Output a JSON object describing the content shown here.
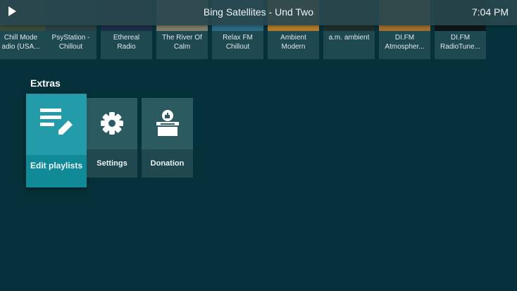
{
  "topbar": {
    "title": "Bing Satellites - Und Two",
    "time": "7:04 PM"
  },
  "stations": [
    {
      "label": "Chill Mode\nadio (USA...",
      "color": "#3a4a3c"
    },
    {
      "label": "PsyStation -\nChillout",
      "color": "#2a3f44"
    },
    {
      "label": "Ethereal\nRadio",
      "color": "#1d2d49"
    },
    {
      "label": "The River Of\nCalm",
      "color": "#7c7a68"
    },
    {
      "label": "Relax FM\nChillout",
      "color": "#2b6b82"
    },
    {
      "label": "Ambient\nModern",
      "color": "#b37a2a"
    },
    {
      "label": "a.m. ambient",
      "color": "#1e2e2a"
    },
    {
      "label": "DI.FM\nAtmospher...",
      "color": "#9c6e2d"
    },
    {
      "label": "DI.FM\nRadioTune...",
      "color": "#101618"
    }
  ],
  "extras": {
    "title": "Extras",
    "items": [
      {
        "label": "Edit playlists",
        "icon": "edit-list-icon"
      },
      {
        "label": "Settings",
        "icon": "gear-icon"
      },
      {
        "label": "Donation",
        "icon": "donation-box-icon"
      }
    ]
  },
  "colors": {
    "background": "#05323a",
    "accent": "#118a98"
  }
}
